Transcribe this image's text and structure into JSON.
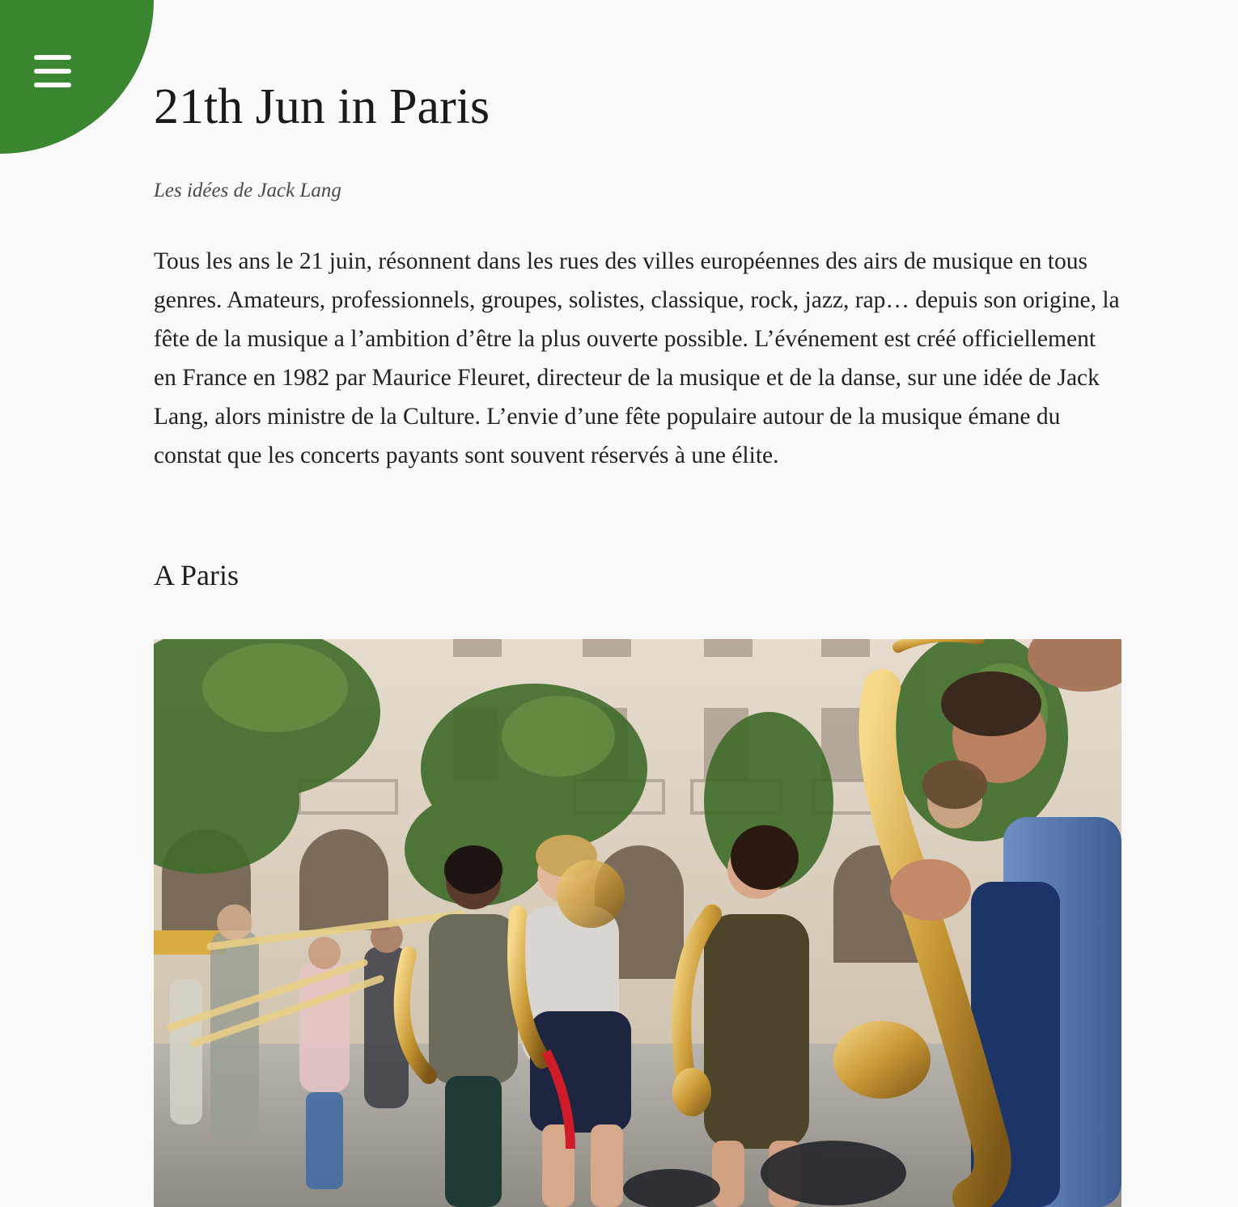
{
  "menu": {
    "icon": "hamburger-menu-icon",
    "color": "#3b8631"
  },
  "article": {
    "title": "21th Jun in Paris",
    "subtitle": "Les idées de Jack Lang",
    "body": "Tous les ans le 21 juin, résonnent dans les rues des villes européennes des airs de musique en tous genres. Amateurs, professionnels, groupes, solistes, classique, rock, jazz, rap… depuis son origine, la fête de la musique a l’ambition d’être la plus ouverte possible. L’événement est créé officiellement en France en 1982 par Maurice Fleuret, directeur de la musique et de la danse, sur une idée de Jack Lang, alors ministre de la Culture. L’envie d’une fête populaire autour de la musique émane du constat que les concerts payants sont souvent réservés à une élite.",
    "section_heading": "A Paris"
  },
  "photo": {
    "subject": "street-band-saxophone-photo"
  }
}
